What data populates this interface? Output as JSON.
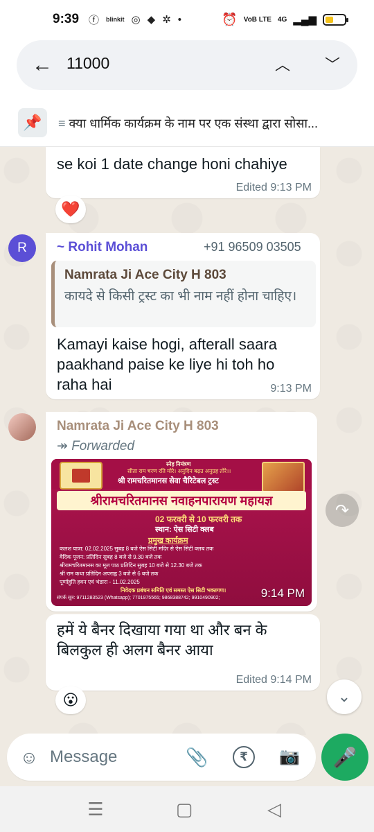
{
  "status_bar": {
    "time": "9:39",
    "icons_left": [
      "facebook-icon",
      "blinkit-icon",
      "chrome-icon",
      "tag-icon",
      "app-icon",
      "dot"
    ],
    "blinkit_label": "blinkit",
    "network_label": "VoB LTE",
    "signal_label": "4G",
    "battery_color": "#f4c21b",
    "battery_level": 0.36
  },
  "search": {
    "query": "11000"
  },
  "pinned": {
    "text": "क्या धार्मिक कार्यक्रम के नाम पर एक संस्था द्वारा सोसा..."
  },
  "messages": [
    {
      "text": "se koi 1 date change honi chahiye",
      "edited_label": "Edited",
      "time": "9:13 PM",
      "reaction": "❤️"
    },
    {
      "avatar_letter": "R",
      "avatar_color": "#5b4fd6",
      "sender": "~ Rohit Mohan",
      "sender_color": "#5b4fd6",
      "phone": "+91 96509 03505",
      "quote_name": "Namrata Ji Ace City H 803",
      "quote_text": "कायदे से किसी ट्रस्ट का भी नाम नहीं होना चाहिए।",
      "text": "Kamayi kaise hogi, afterall saara paakhand paise ke liye hi toh ho raha hai",
      "time": "9:13 PM"
    },
    {
      "sender": "Namrata Ji Ace City H 803",
      "sender_color": "#a88f7b",
      "forwarded_label": "Forwarded",
      "time": "9:14 PM",
      "banner": {
        "invite": "स्नेह निमंत्रण",
        "blessing": "सीता राम चरण रति मोरे। अनुदिन बढ़उ अनुग्रह तोरे।।",
        "trust": "श्री रामचरितमानस सेवा चैरिटेबल ट्रस्ट",
        "headline": "श्रीरामचरितमानस नवाहनपारायण महायज्ञ",
        "dates": "02 फरवरी से 10 फरवरी तक",
        "venue": "स्थान: ऐस सिटी क्लब",
        "program_title": "प्रमुख कार्यक्रम",
        "program_items": [
          "कलश यात्रा: 02.02.2025 सुबह 8 बजे ऐस सिटी मंदिर से ऐस सिटी क्लब तक",
          "वैदिक पूजन: प्रतिदिन सुबह 8 बजे से 9.30 बजे तक",
          "श्रीरामचरितमानस का मूल पाठ प्रतिदिन सुबह 10 बजे से 12.30 बजे तक",
          "श्री राम कथा प्रतिदिन अपराह्न 3 बजे से 6 बजे तक",
          "पूर्णाहुति हवन एवं भंडारा - 11.02.2025"
        ],
        "organizer": "निवेदक प्रबंधन समिति एवं समस्त ऐस सिटी भक्तगण।",
        "contact": "संपर्क सूत्र: 9711283523 (Whatsapp); 7701975565; 9868388742; 9910490902;"
      }
    },
    {
      "text": "हमें ये बैनर दिखाया गया था और बन के बिलकुल ही अलग बैनर आया",
      "edited_label": "Edited",
      "time": "9:14 PM",
      "reaction": "😮"
    }
  ],
  "composer": {
    "placeholder": "Message"
  }
}
